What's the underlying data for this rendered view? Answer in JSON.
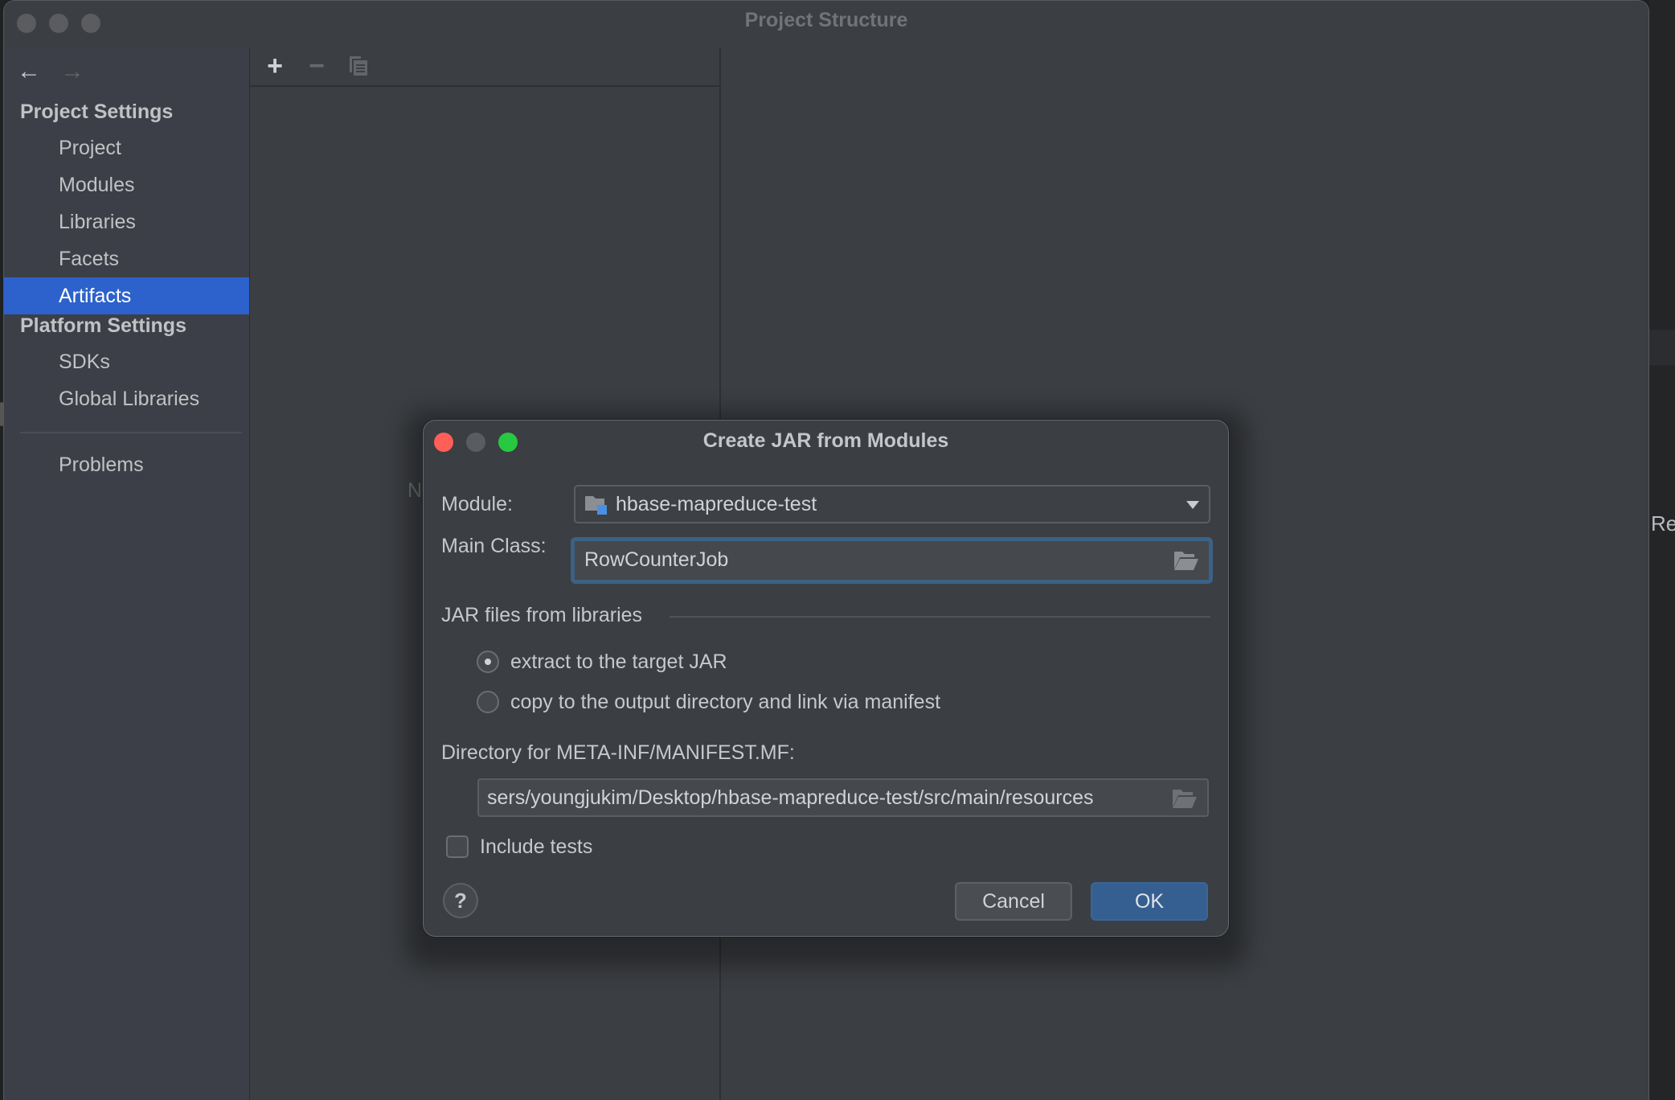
{
  "window": {
    "title": "Project Structure"
  },
  "sidebar": {
    "nav": {
      "back_icon": "arrow-left-icon",
      "forward_icon": "arrow-right-icon"
    },
    "sections": [
      {
        "heading": "Project Settings",
        "items": [
          {
            "label": "Project",
            "selected": false
          },
          {
            "label": "Modules",
            "selected": false
          },
          {
            "label": "Libraries",
            "selected": false
          },
          {
            "label": "Facets",
            "selected": false
          },
          {
            "label": "Artifacts",
            "selected": true
          }
        ]
      },
      {
        "heading": "Platform Settings",
        "items": [
          {
            "label": "SDKs",
            "selected": false
          },
          {
            "label": "Global Libraries",
            "selected": false
          }
        ]
      }
    ],
    "footer_items": [
      {
        "label": "Problems"
      }
    ]
  },
  "middle_panel": {
    "toolbar": {
      "add_icon": "plus-icon",
      "remove_icon": "minus-icon",
      "copy_icon": "copy-icon"
    },
    "partial_text": "N"
  },
  "outside": {
    "partial_text": "Re"
  },
  "dialog": {
    "title": "Create JAR from Modules",
    "module_label": "Module:",
    "module_value": "hbase-mapreduce-test",
    "main_class_label": "Main Class:",
    "main_class_value": "RowCounterJob",
    "libraries_group_title": "JAR files from libraries",
    "options": [
      {
        "label": "extract to the target JAR",
        "checked": true
      },
      {
        "label": "copy to the output directory and link via manifest",
        "checked": false
      }
    ],
    "manifest_dir_label": "Directory for META-INF/MANIFEST.MF:",
    "manifest_dir_value": "sers/youngjukim/Desktop/hbase-mapreduce-test/src/main/resources",
    "include_tests_label": "Include tests",
    "include_tests_checked": false,
    "help_label": "?",
    "cancel_label": "Cancel",
    "ok_label": "OK"
  },
  "colors": {
    "selection": "#2d62cc",
    "focus_ring": "#3d6185",
    "ok_button": "#365f91",
    "traffic_red": "#fe5f57",
    "traffic_green": "#28c840"
  }
}
